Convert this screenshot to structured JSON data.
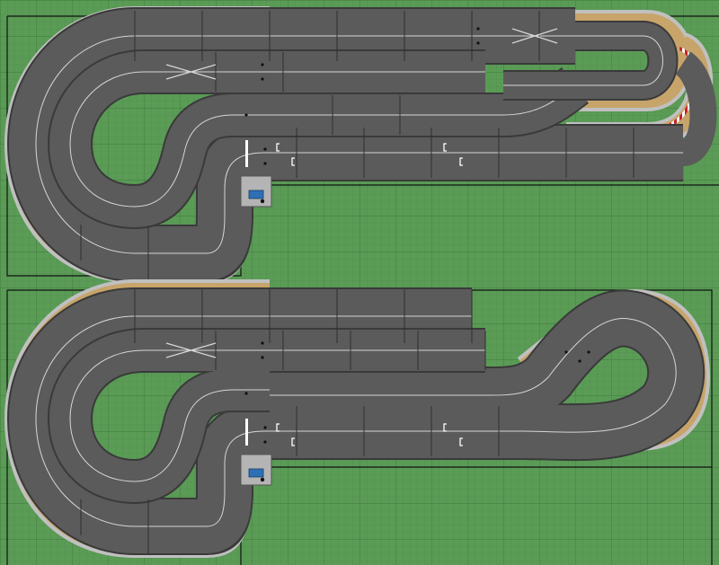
{
  "canvas": {
    "background": "#5a9b56",
    "grid_minor": "#4e8c4a",
    "grid_major": "#3f7a3c"
  },
  "colors": {
    "track": "#5b5b5b",
    "track_edge": "#3a3a3a",
    "lane_line": "#d6d6d6",
    "seam": "#2f2f2f",
    "border_outer": "#c0c0c0",
    "border_band": "#c7a46a",
    "curb_red": "#c8202a",
    "curb_white": "#ffffff",
    "outline": "#111111",
    "console_body": "#b4b4b4",
    "console_screen": "#2f6fb5"
  },
  "layouts": [
    {
      "name": "layout-top",
      "variant": "figure-eight-loop"
    },
    {
      "name": "layout-bottom",
      "variant": "open-straights-loop"
    }
  ],
  "icons": {
    "control_unit": "control-unit-icon",
    "lap_counter": "lap-counter-icon",
    "start_line": "start-finish-line-icon"
  }
}
